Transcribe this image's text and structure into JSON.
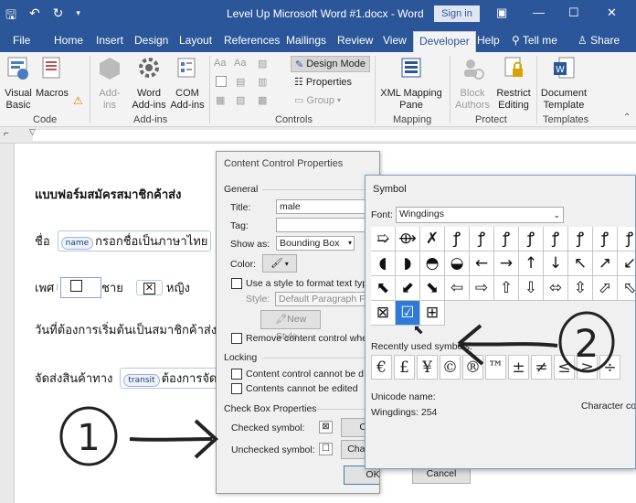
{
  "titlebar": {
    "title": "Level Up Microsoft Word #1.docx  -  Word",
    "signin": "Sign in",
    "min": "—",
    "max": "☐",
    "close": "✕"
  },
  "tabs": [
    "File",
    "Home",
    "Insert",
    "Design",
    "Layout",
    "References",
    "Mailings",
    "Review",
    "View",
    "Developer",
    "Help"
  ],
  "tell_me": "Tell me",
  "share": "Share",
  "ribbon": {
    "code": {
      "visual_basic": "Visual Basic",
      "macros": "Macros",
      "label": "Code"
    },
    "addins": {
      "addins": "Add-ins",
      "word_addins": "Word Add-ins",
      "com_addins": "COM Add-ins",
      "label": "Add-ins"
    },
    "controls": {
      "design_mode": "Design Mode",
      "properties": "Properties",
      "group": "Group",
      "label": "Controls"
    },
    "mapping": {
      "xml_mapping": "XML Mapping Pane",
      "label": "Mapping"
    },
    "protect": {
      "block_authors": "Block Authors",
      "restrict_editing": "Restrict Editing",
      "label": "Protect"
    },
    "templates": {
      "document_template": "Document Template",
      "label": "Templates"
    }
  },
  "document": {
    "heading": "แบบฟอร์มสมัครสมาชิกค้าส่ง",
    "name_label": "ชื่อ",
    "name_tag": "name",
    "name_placeholder": "กรอกชื่อเป็นภาษาไทย",
    "gender_label": "เพศ",
    "male": "ชาย",
    "female": "หญิง",
    "date_label": "วันที่ต้องการเริ่มต้นเป็นสมาชิกค้าส่ง",
    "ship_label": "จัดส่งสินค้าทาง",
    "transit_tag": "transit",
    "ship_placeholder": "ต้องการจัดส่ง"
  },
  "ccp_dialog": {
    "title": "Content Control Properties",
    "help": "?",
    "general": "General",
    "title_label": "Title:",
    "title_value": "male",
    "tag_label": "Tag:",
    "tag_value": "",
    "show_as_label": "Show as:",
    "show_as_value": "Bounding Box",
    "color_label": "Color:",
    "use_style": "Use a style to format text typ",
    "style_label": "Style:",
    "style_value": "Default Paragraph Fo",
    "new_style": "New Style...",
    "remove_cc": "Remove content control whe",
    "locking": "Locking",
    "lock_delete": "Content control cannot be d",
    "lock_edit": "Contents cannot be edited",
    "checkbox_props": "Check Box Properties",
    "checked_symbol": "Checked symbol:",
    "unchecked_symbol": "Unchecked symbol:",
    "change": "Change...",
    "change_short": "Cha",
    "ok": "OK",
    "cancel": "Cancel"
  },
  "symbol_dialog": {
    "title": "Symbol",
    "font_label": "Font:",
    "font_value": "Wingdings",
    "rows": [
      [
        "➯",
        "⟴",
        "✗",
        "ꝭ",
        "ꝭ",
        "ꝭ",
        "ꝭ",
        "ꝭ",
        "ꝭ",
        "ꝭ",
        "ꝭ"
      ],
      [
        "◖",
        "◗",
        "◓",
        "◒",
        "←",
        "→",
        "↑",
        "↓",
        "↖",
        "↗",
        "↙"
      ],
      [
        "⬉",
        "⬋",
        "⬊",
        "⇦",
        "⇨",
        "⇧",
        "⇩",
        "⬄",
        "⇳",
        "⬀",
        "⬁"
      ],
      [
        "⊠",
        "☑",
        "⊞"
      ]
    ],
    "recent_label": "Recently used symbols:",
    "recent": [
      "€",
      "£",
      "¥",
      "©",
      "®",
      "™",
      "±",
      "≠",
      "≤",
      "≥",
      "÷"
    ],
    "unicode_label": "Unicode name:",
    "unicode_value": "Wingdings: 254",
    "char_code_label": "Character co"
  },
  "annotations": {
    "one": "1",
    "two": "2"
  }
}
